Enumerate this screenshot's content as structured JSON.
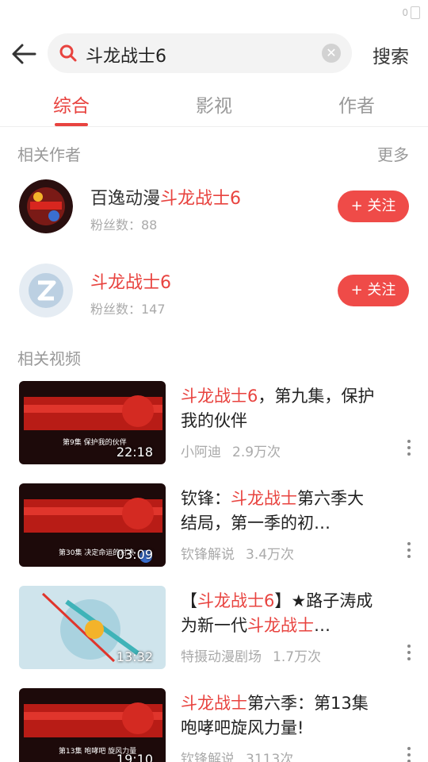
{
  "status": {
    "battery_text": "0"
  },
  "search": {
    "query": "斗龙战士6",
    "submit_label": "搜索"
  },
  "tabs": [
    {
      "label": "综合",
      "active": true
    },
    {
      "label": "影视",
      "active": false
    },
    {
      "label": "作者",
      "active": false
    }
  ],
  "authors_section": {
    "title": "相关作者",
    "more_label": "更多",
    "items": [
      {
        "name_prefix": "百逸动漫",
        "name_highlight": "斗龙战士6",
        "fans": "粉丝数：88",
        "follow_label": "关注"
      },
      {
        "name_prefix": "",
        "name_highlight": "斗龙战士6",
        "fans": "粉丝数：147",
        "follow_label": "关注"
      }
    ]
  },
  "videos_section": {
    "title": "相关视频",
    "items": [
      {
        "title_parts": [
          {
            "text": "斗龙战士6",
            "hl": true
          },
          {
            "text": "，第九集，保护我的伙伴",
            "hl": false
          }
        ],
        "author": "小阿迪",
        "views": "2.9万次",
        "duration": "22:18",
        "thumb_caption": "第9集 保护我的伙伴"
      },
      {
        "title_parts": [
          {
            "text": "钦锋：",
            "hl": false
          },
          {
            "text": "斗龙战士",
            "hl": true
          },
          {
            "text": "第六季大结局，第一季的初…",
            "hl": false
          }
        ],
        "author": "钦锋解说",
        "views": "3.4万次",
        "duration": "03:09",
        "thumb_caption": "第30集 决定命运的对决"
      },
      {
        "title_parts": [
          {
            "text": "【",
            "hl": false
          },
          {
            "text": "斗龙战士6",
            "hl": true
          },
          {
            "text": "】★路子涛成为新一代",
            "hl": false
          },
          {
            "text": "斗龙战士",
            "hl": true
          },
          {
            "text": "…",
            "hl": false
          }
        ],
        "author": "特摄动漫剧场",
        "views": "1.7万次",
        "duration": "13:32",
        "thumb_caption": ""
      },
      {
        "title_parts": [
          {
            "text": "斗龙战士",
            "hl": true
          },
          {
            "text": "第六季：第13集咆哮吧旋风力量!",
            "hl": false
          }
        ],
        "author": "钦锋解说",
        "views": "3113次",
        "duration": "19:10",
        "thumb_caption": "第13集 咆哮吧 旋风力量"
      }
    ]
  },
  "colors": {
    "accent": "#e8433f",
    "follow_bg": "#ef4b48"
  },
  "icons": [
    "back-arrow-icon",
    "search-icon",
    "clear-icon",
    "plus-icon",
    "more-dots-icon"
  ]
}
